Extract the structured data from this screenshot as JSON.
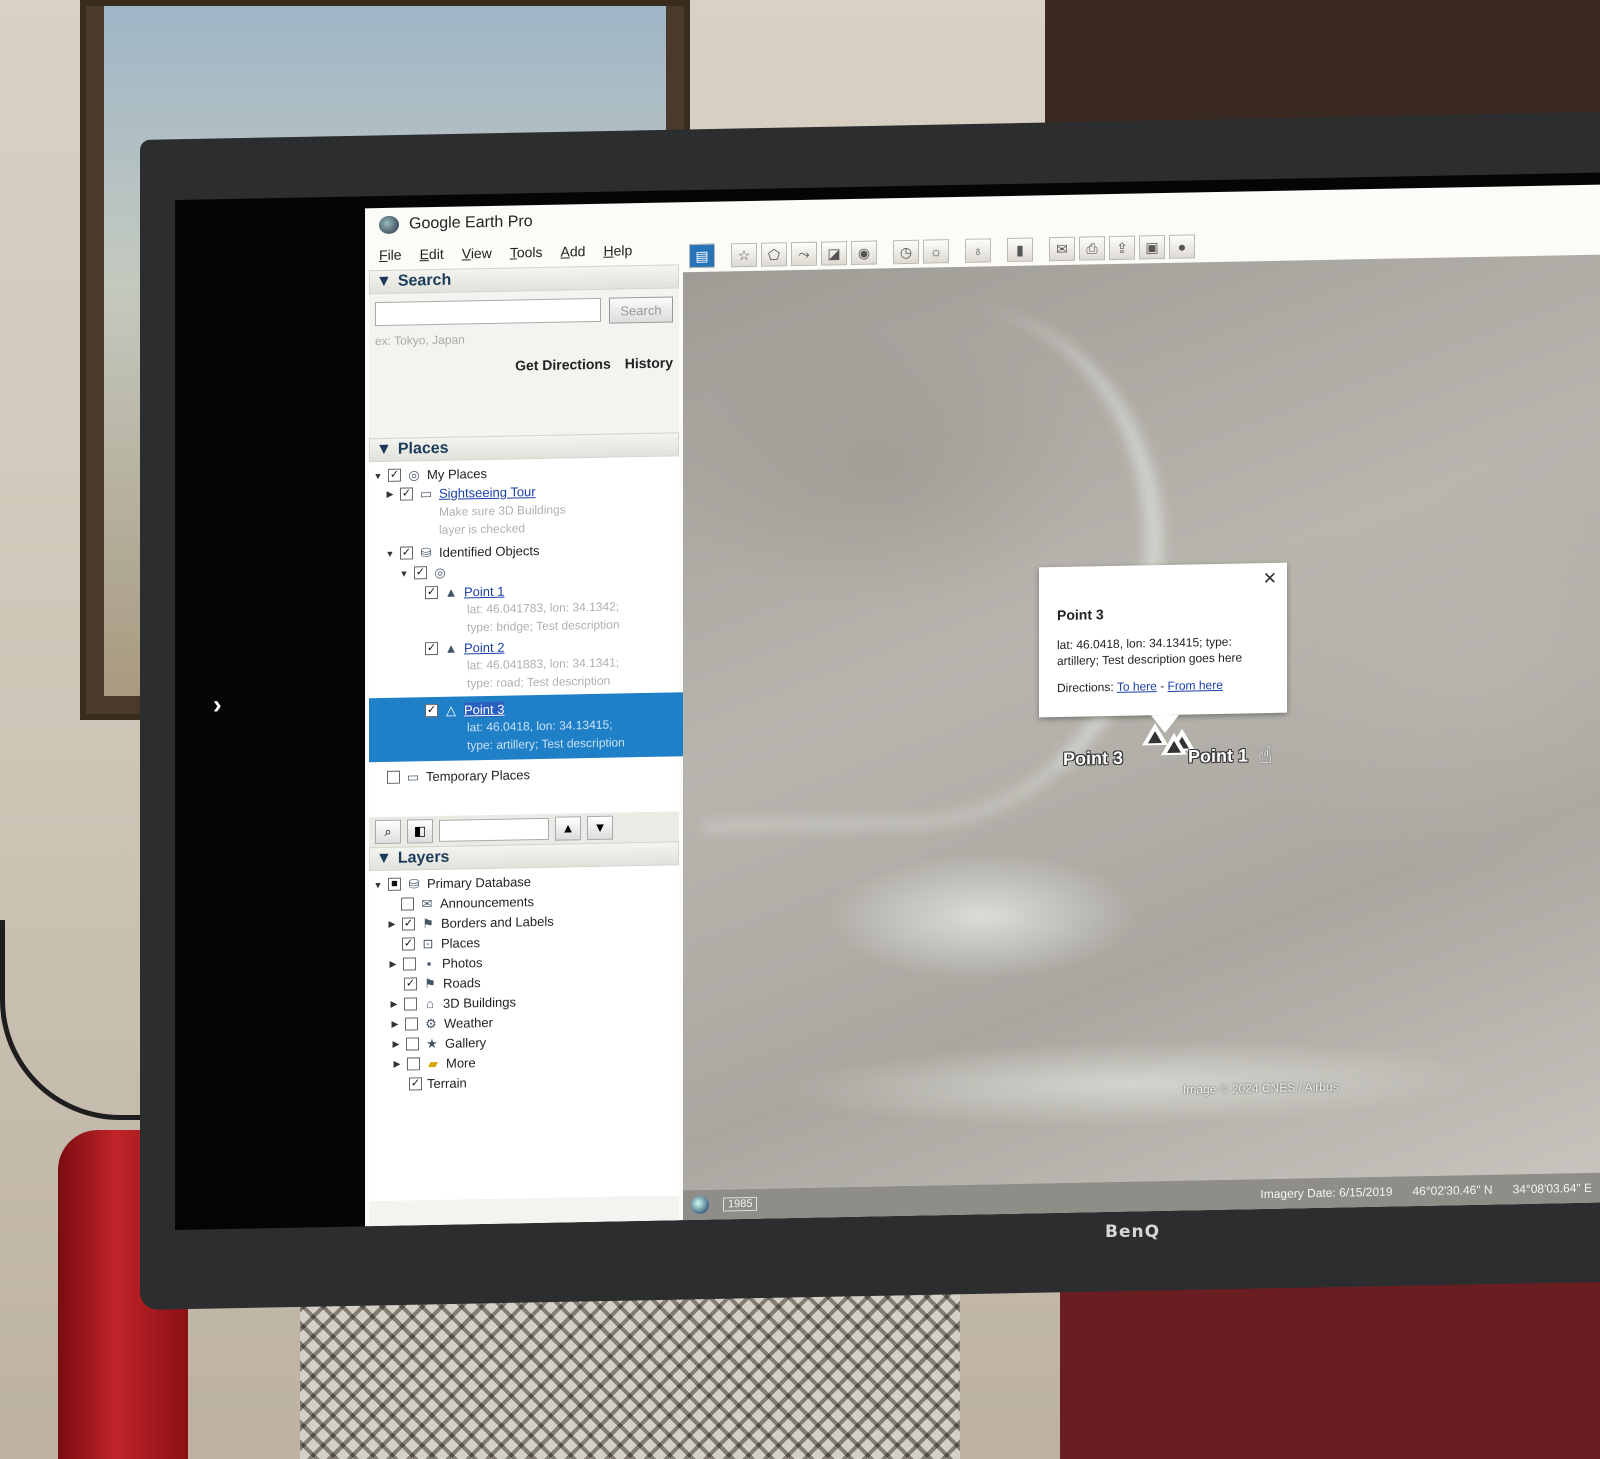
{
  "window": {
    "title": "Google Earth Pro"
  },
  "menu": [
    "File",
    "Edit",
    "View",
    "Tools",
    "Add",
    "Help"
  ],
  "search": {
    "header": "Search",
    "placeholder": "",
    "button_label": "Search",
    "example": "ex: Tokyo, Japan",
    "get_directions": "Get Directions",
    "history": "History"
  },
  "places": {
    "header": "Places",
    "my_places": "My Places",
    "sightseeing_tour": "Sightseeing Tour",
    "sightseeing_desc_1": "Make sure 3D Buildings",
    "sightseeing_desc_2": "layer is checked",
    "identified_objects": "Identified Objects",
    "points": [
      {
        "name": "Point 1",
        "desc_1": "lat: 46.041783, lon: 34.1342;",
        "desc_2": "type: bridge; Test description"
      },
      {
        "name": "Point 2",
        "desc_1": "lat: 46.041883, lon: 34.1341;",
        "desc_2": "type: road; Test description"
      },
      {
        "name": "Point 3",
        "desc_1": "lat: 46.0418, lon: 34.13415;",
        "desc_2": "type: artillery; Test description"
      }
    ],
    "temporary_places": "Temporary Places"
  },
  "layers": {
    "header": "Layers",
    "items": [
      {
        "label": "Primary Database",
        "icon": "database-icon",
        "checked": true
      },
      {
        "label": "Announcements",
        "icon": "envelope-icon",
        "checked": false
      },
      {
        "label": "Borders and Labels",
        "icon": "flag-icon",
        "checked": true
      },
      {
        "label": "Places",
        "icon": "places-icon",
        "checked": true
      },
      {
        "label": "Photos",
        "icon": "photo-icon",
        "checked": false
      },
      {
        "label": "Roads",
        "icon": "flag-icon",
        "checked": true
      },
      {
        "label": "3D Buildings",
        "icon": "buildings-icon",
        "checked": false
      },
      {
        "label": "Weather",
        "icon": "gear-icon",
        "checked": false
      },
      {
        "label": "Gallery",
        "icon": "star-icon",
        "checked": false
      },
      {
        "label": "More",
        "icon": "folder-icon",
        "checked": false
      },
      {
        "label": "Terrain",
        "icon": "",
        "checked": true
      }
    ]
  },
  "popup": {
    "title": "Point 3",
    "desc_1": "lat: 46.0418, lon: 34.13415; type:",
    "desc_2": "artillery; Test description goes here",
    "directions_label": "Directions:",
    "to_here": "To here",
    "separator": "-",
    "from_here": "From here"
  },
  "map": {
    "label_point3": "Point 3",
    "label_point1": "Point 1",
    "copyright": "Image © 2024 CNES / Airbus"
  },
  "status": {
    "year": "1985",
    "imagery_date": "Imagery Date: 6/15/2019",
    "lat": "46°02'30.46\" N",
    "lon": "34°08'03.64\" E"
  },
  "monitor": {
    "brand": "BenQ"
  },
  "colors": {
    "selection": "#1f7fc7",
    "link": "#1a3fa8",
    "header_text": "#1b3b5a"
  }
}
